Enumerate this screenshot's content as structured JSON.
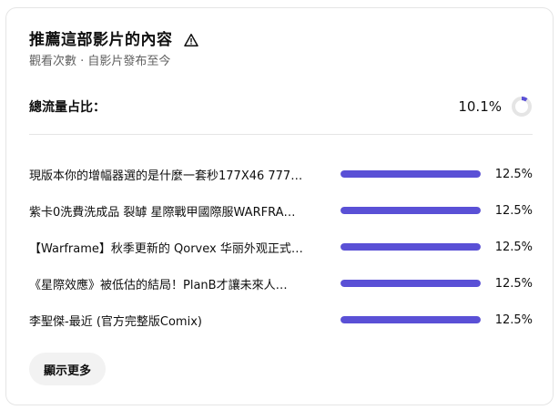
{
  "header": {
    "title": "推薦這部影片的內容",
    "subtitle": "觀看次數 · 自影片發布至今",
    "info_icon": "warning-triangle-icon"
  },
  "total": {
    "label": "總流量占比：",
    "value": "10.1%",
    "fraction": 0.101
  },
  "videos": [
    {
      "title": "現版本你的增幅器選的是什麼一套秒177X46 777…",
      "percent": "12.5%",
      "fraction": 1.0
    },
    {
      "title": "紫卡0洗費洗成品 裂罅 星際戰甲國際服WARFRA…",
      "percent": "12.5%",
      "fraction": 1.0
    },
    {
      "title": "【Warframe】秋季更新的 Qorvex 华丽外观正式…",
      "percent": "12.5%",
      "fraction": 1.0
    },
    {
      "title": "《星際效應》被低估的結局！PlanB才讓未來人…",
      "percent": "12.5%",
      "fraction": 1.0
    },
    {
      "title": "李聖傑-最近 (官方完整版Comix)",
      "percent": "12.5%",
      "fraction": 1.0
    }
  ],
  "actions": {
    "show_more": "顯示更多"
  },
  "colors": {
    "accent": "#5a50d6",
    "track": "#e5e5e5"
  }
}
